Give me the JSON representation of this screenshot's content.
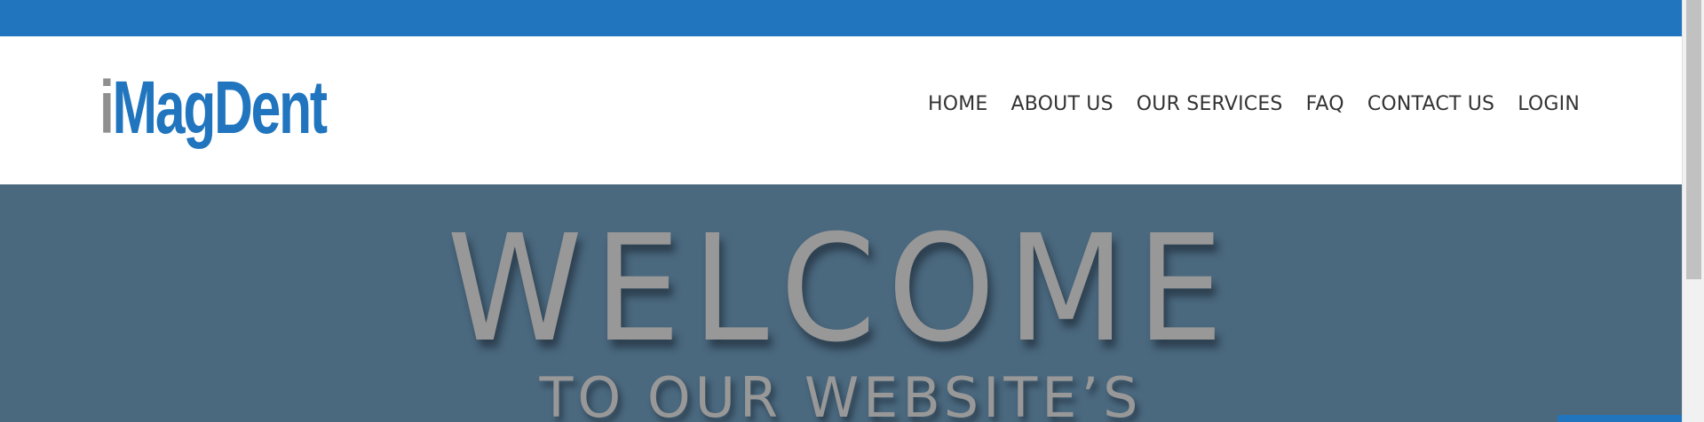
{
  "brand": {
    "logo_first": "i",
    "logo_rest": "MagDent"
  },
  "nav": {
    "items": [
      "HOME",
      "ABOUT US",
      "OUR SERVICES",
      "FAQ",
      "CONTACT US",
      "LOGIN"
    ]
  },
  "hero": {
    "title": "WELCOME",
    "subtitle": "TO OUR WEBSITE’S"
  },
  "colors": {
    "accent": "#2075be",
    "hero_bg": "#4a687e",
    "nav_text": "#333333",
    "logo_gray": "#8f8f8f"
  }
}
